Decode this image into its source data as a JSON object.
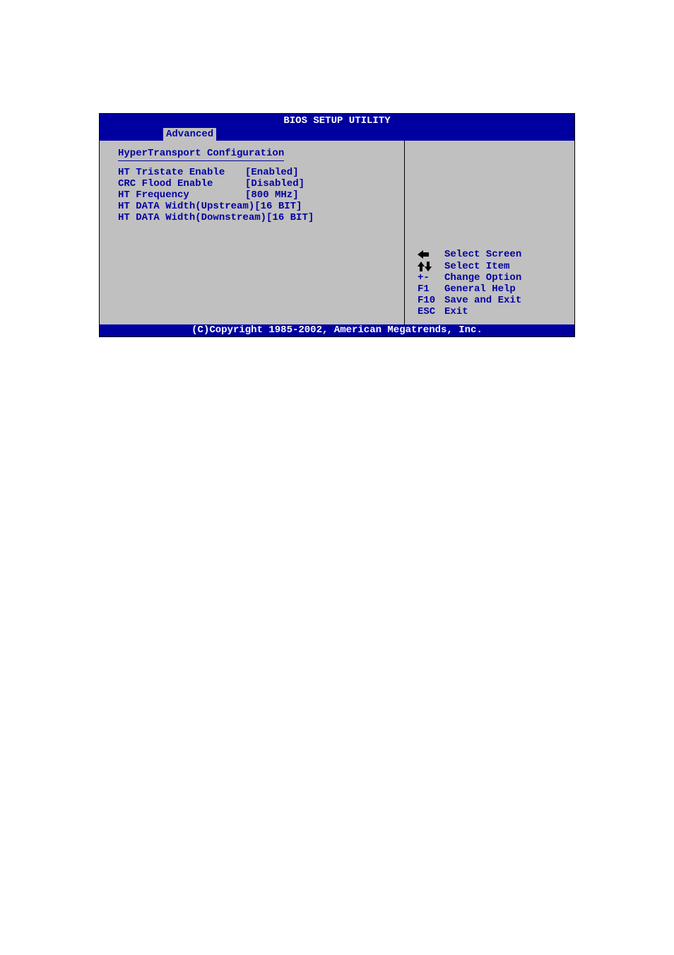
{
  "title": "BIOS SETUP UTILITY",
  "tab": "Advanced",
  "section_header": "HyperTransport Configuration",
  "options": [
    {
      "label": "HT Tristate Enable",
      "value": "[Enabled]"
    },
    {
      "label": "CRC Flood Enable",
      "value": "[Disabled]"
    },
    {
      "label": "HT Frequency",
      "value": "[800 MHz]"
    },
    {
      "label": "HT DATA Width(Upstream)",
      "value": "[16 BIT]"
    },
    {
      "label": "HT DATA Width(Downstream)",
      "value": "[16 BIT]"
    }
  ],
  "help": [
    {
      "key_icon": "arrow-left",
      "key_text": "",
      "desc": "Select Screen"
    },
    {
      "key_icon": "arrows-updown",
      "key_text": "",
      "desc": "Select Item"
    },
    {
      "key_icon": "",
      "key_text": "+-",
      "desc": "Change Option"
    },
    {
      "key_icon": "",
      "key_text": "F1",
      "desc": "General Help"
    },
    {
      "key_icon": "",
      "key_text": "F10",
      "desc": "Save and Exit"
    },
    {
      "key_icon": "",
      "key_text": "ESC",
      "desc": "Exit"
    }
  ],
  "footer": "(C)Copyright 1985-2002, American Megatrends, Inc."
}
